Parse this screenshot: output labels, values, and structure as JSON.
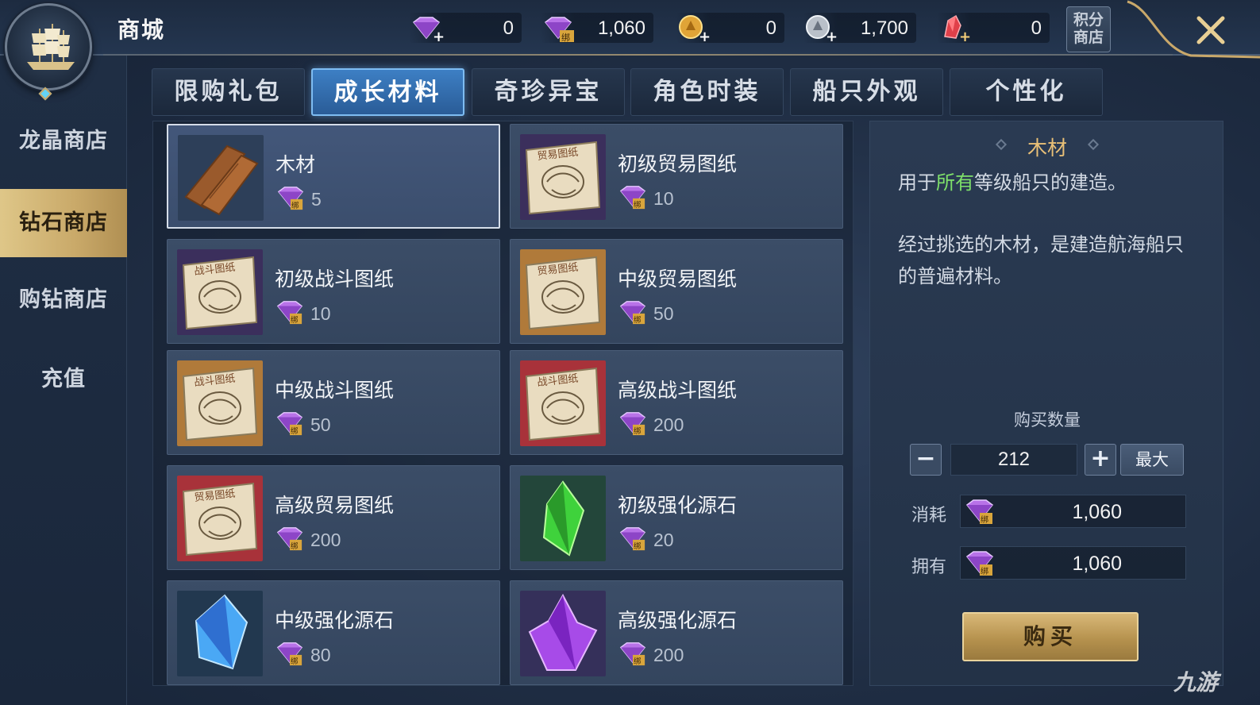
{
  "header": {
    "title": "商城",
    "currencies": [
      {
        "icon": "diamond-plus-icon",
        "value": "0"
      },
      {
        "icon": "bound-diamond-icon",
        "value": "1,060"
      },
      {
        "icon": "gold-coin-plus-icon",
        "value": "0"
      },
      {
        "icon": "silver-coin-plus-icon",
        "value": "1,700"
      },
      {
        "icon": "red-crystal-plus-icon",
        "value": "0"
      }
    ],
    "points_shop_label_line1": "积分",
    "points_shop_label_line2": "商店"
  },
  "sidebar": {
    "items": [
      {
        "label": "龙晶商店"
      },
      {
        "label": "钻石商店"
      },
      {
        "label": "购钻商店"
      },
      {
        "label": "充值"
      }
    ],
    "active_index": 1
  },
  "tabs": [
    {
      "label": "限购礼包"
    },
    {
      "label": "成长材料"
    },
    {
      "label": "奇珍异宝"
    },
    {
      "label": "角色时装"
    },
    {
      "label": "船只外观"
    },
    {
      "label": "个性化"
    }
  ],
  "active_tab": 1,
  "items": [
    {
      "name": "木材",
      "price": "5",
      "icon": "wood-planks-icon",
      "bg": "#2d3f59"
    },
    {
      "name": "初级贸易图纸",
      "price": "10",
      "icon": "trade-blueprint-icon",
      "bg": "#3b2f5c",
      "stamp": "贸易图纸"
    },
    {
      "name": "初级战斗图纸",
      "price": "10",
      "icon": "battle-blueprint-icon",
      "bg": "#3b2f5c",
      "stamp": "战斗图纸"
    },
    {
      "name": "中级贸易图纸",
      "price": "50",
      "icon": "trade-blueprint-icon",
      "bg": "#b07a3a",
      "stamp": "贸易图纸"
    },
    {
      "name": "中级战斗图纸",
      "price": "50",
      "icon": "battle-blueprint-icon",
      "bg": "#b07a3a",
      "stamp": "战斗图纸"
    },
    {
      "name": "高级战斗图纸",
      "price": "200",
      "icon": "battle-blueprint-icon",
      "bg": "#a8323a",
      "stamp": "战斗图纸"
    },
    {
      "name": "高级贸易图纸",
      "price": "200",
      "icon": "trade-blueprint-icon",
      "bg": "#a8323a",
      "stamp": "贸易图纸"
    },
    {
      "name": "初级强化源石",
      "price": "20",
      "icon": "green-crystal-icon",
      "bg": "#23463a"
    },
    {
      "name": "中级强化源石",
      "price": "80",
      "icon": "blue-crystal-icon",
      "bg": "#22384f"
    },
    {
      "name": "高级强化源石",
      "price": "200",
      "icon": "purple-crystal-icon",
      "bg": "#35305a"
    }
  ],
  "selected_item": 0,
  "detail": {
    "title": "木材",
    "desc1_before": "用于",
    "desc1_highlight": "所有",
    "desc1_after": "等级船只的建造。",
    "desc2": "经过挑选的木材，是建造航海船只的普遍材料。",
    "quantity_label": "购买数量",
    "quantity": "212",
    "minus_label": "−",
    "plus_label": "+",
    "max_label": "最大",
    "cost_label": "消耗",
    "cost_value": "1,060",
    "own_label": "拥有",
    "own_value": "1,060",
    "buy_label": "购买"
  },
  "watermark": "九游",
  "colors": {
    "accent_gold": "#c9a86a",
    "tab_active": "#3d7fc4",
    "detail_title": "#e9c077",
    "highlight_green": "#7ee06a"
  }
}
